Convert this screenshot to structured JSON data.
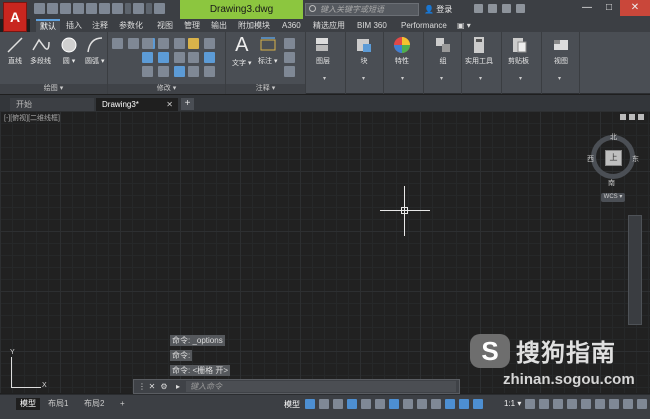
{
  "app": {
    "logo_letter": "A",
    "doc_title": "Drawing3.dwg",
    "search_placeholder": "键入关键字或短语",
    "login": "登录",
    "window_controls": [
      "—",
      "□",
      "✕"
    ]
  },
  "ribbon_tabs": [
    "默认",
    "插入",
    "注释",
    "参数化",
    "视图",
    "管理",
    "输出",
    "附加模块",
    "A360",
    "精选应用",
    "BIM 360",
    "Performance"
  ],
  "ribbon_panels": {
    "draw": {
      "title": "绘图 ▾",
      "tools": [
        "直线",
        "多段线",
        "圆",
        "圆弧"
      ]
    },
    "modify": {
      "title": "修改 ▾"
    },
    "annotation": {
      "title": "注释 ▾",
      "tools": [
        "文字",
        "标注"
      ]
    },
    "groups": [
      "图层",
      "块",
      "特性",
      "组",
      "实用工具",
      "剪贴板",
      "视图"
    ]
  },
  "file_tabs": {
    "start": "开始",
    "doc": "Drawing3*",
    "add": "+"
  },
  "viewport": {
    "viewcube": {
      "north": "北",
      "south": "南",
      "east": "东",
      "west": "西",
      "face": "上",
      "wcs": "WCS ▾"
    },
    "ucs": {
      "x": "X",
      "y": "Y"
    }
  },
  "command_history": [
    "命令: _options",
    "命令:",
    "命令: <栅格 开>"
  ],
  "command_line": {
    "placeholder": "键入命令",
    "close": "✕",
    "settings": "🔧"
  },
  "watermark": {
    "icon": "S",
    "text": "搜狗指南",
    "url": "zhinan.sogou.com"
  },
  "status_bar": {
    "layouts": [
      "模型",
      "布局1",
      "布局2"
    ],
    "add": "+",
    "model_label": "模型",
    "scale": "1:1 ▾"
  }
}
